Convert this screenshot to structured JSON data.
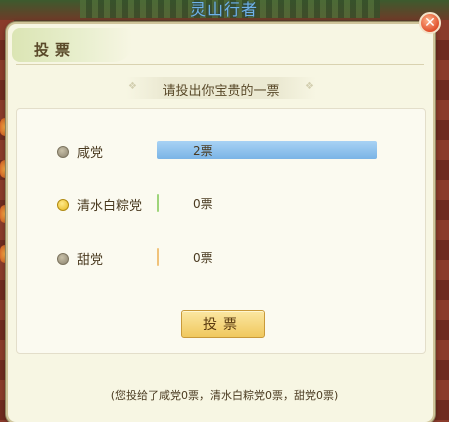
{
  "background": {
    "name_text": "灵山行者"
  },
  "dialog": {
    "title": "投票",
    "subtitle": "请投出你宝贵的一票",
    "options": [
      {
        "label": "咸党",
        "votes": 2,
        "count_text": "2票",
        "share": 1.0,
        "selected": false,
        "color": "#8fc1ee"
      },
      {
        "label": "清水白粽党",
        "votes": 0,
        "count_text": "0票",
        "share": 0.0,
        "selected": true,
        "color": "#9ed47a"
      },
      {
        "label": "甜党",
        "votes": 0,
        "count_text": "0票",
        "share": 0.0,
        "selected": false,
        "color": "#f0c27a"
      }
    ],
    "vote_button_label": "投票",
    "footer_text": "(您投给了咸党0票，清水白粽党0票，甜党0票)"
  },
  "colors": {
    "dialog_bg": "#f7f6e3",
    "button_gold": "#f0c85e",
    "close_red": "#e0502c"
  }
}
